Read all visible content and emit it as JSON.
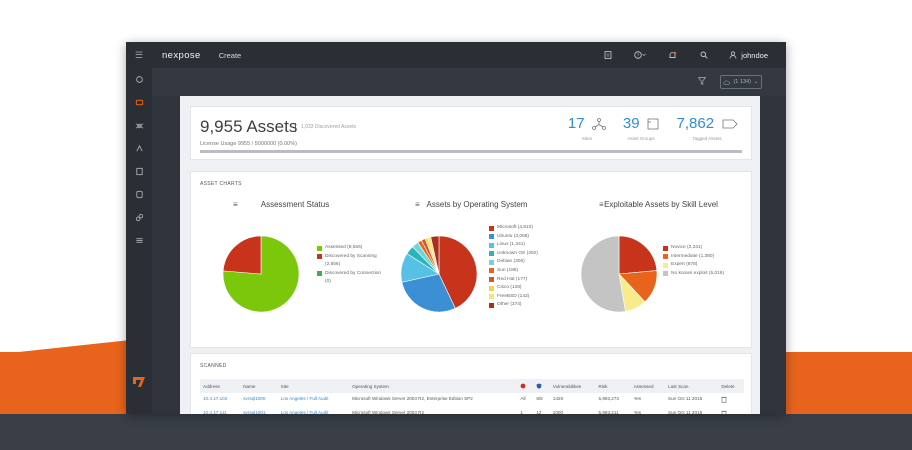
{
  "header": {
    "brand": "nexpose",
    "create_label": "Create",
    "username": "johndoe"
  },
  "subbar": {
    "cloud_filter": "(1 134)"
  },
  "summary": {
    "asset_count": "9,955 Assets",
    "asset_sub": "1,033 Discovered Assets",
    "usage_text": "License Usage 9955 / 5000000 (0.00%)",
    "usage_fraction": 1.0,
    "stats": [
      {
        "value": "17",
        "label": "Sites",
        "icon": "sites-icon"
      },
      {
        "value": "39",
        "label": "Asset Groups",
        "icon": "asset-groups-icon"
      },
      {
        "value": "7,862",
        "label": "Tagged Assets",
        "icon": "tag-icon"
      }
    ]
  },
  "charts_section": {
    "title": "ASSET CHARTS"
  },
  "chart_data": [
    {
      "type": "pie",
      "title": "Assessment Status",
      "slices": [
        {
          "label": "Assessed (8,555)",
          "value": 8555,
          "color": "#7ac70c"
        },
        {
          "label": "Discovered by Scanning (2,656)",
          "value": 2656,
          "color": "#c8331b"
        },
        {
          "label": "Discovered by Connection (0)",
          "value": 0,
          "color": "#3fae5b"
        }
      ]
    },
    {
      "type": "pie",
      "title": "Assets by Operating System",
      "slices": [
        {
          "label": "Microsoft (4,610)",
          "value": 4610,
          "color": "#c8331b"
        },
        {
          "label": "Ubuntu (3,068)",
          "value": 3068,
          "color": "#3b8fd4"
        },
        {
          "label": "Linux (1,341)",
          "value": 1341,
          "color": "#56c0e5"
        },
        {
          "label": "Unknown OS (402)",
          "value": 402,
          "color": "#2ab5b8"
        },
        {
          "label": "Debian (306)",
          "value": 306,
          "color": "#6ed6d8"
        },
        {
          "label": "Sun (188)",
          "value": 188,
          "color": "#e8641c"
        },
        {
          "label": "Red Hat (177)",
          "value": 177,
          "color": "#d4572a"
        },
        {
          "label": "Cisco (128)",
          "value": 128,
          "color": "#f2d54e"
        },
        {
          "label": "FreeBSD (143)",
          "value": 143,
          "color": "#f7e27f"
        },
        {
          "label": "Other (374)",
          "value": 374,
          "color": "#a8301d"
        }
      ]
    },
    {
      "type": "pie",
      "title": "Exploitable Assets by Skill Level",
      "slices": [
        {
          "label": "Novice (2,241)",
          "value": 2241,
          "color": "#c8331b"
        },
        {
          "label": "Intermediate (1,380)",
          "value": 1380,
          "color": "#e8641c"
        },
        {
          "label": "Expert (878)",
          "value": 878,
          "color": "#f7eb8c"
        },
        {
          "label": "No known exploit (5,016)",
          "value": 5016,
          "color": "#c4c4c4"
        }
      ]
    }
  ],
  "table": {
    "title": "SCANNED",
    "columns": [
      "Address",
      "Name",
      "Site",
      "Operating System",
      "",
      "",
      "Vulnerabilities",
      "Risk",
      "Assessed",
      "Last Scan",
      "Delete"
    ],
    "rows": [
      [
        "10.4.17.102",
        "svrsql1000",
        "Los Angeles / Full Audit",
        "Microsoft Windows Server 2003 R2, Enterprise Edition SP2",
        "All",
        "8/8",
        "1429",
        "5,993,273",
        "Yes",
        "Sun Oct 11 2015",
        ""
      ],
      [
        "10.4.17.111",
        "svrsql1001",
        "Los Angeles / Full Audit",
        "Microsoft Windows Server 2003 R2",
        "1",
        "12",
        "1000",
        "5,993,211",
        "Yes",
        "Sun Oct 11 2015",
        ""
      ]
    ]
  }
}
